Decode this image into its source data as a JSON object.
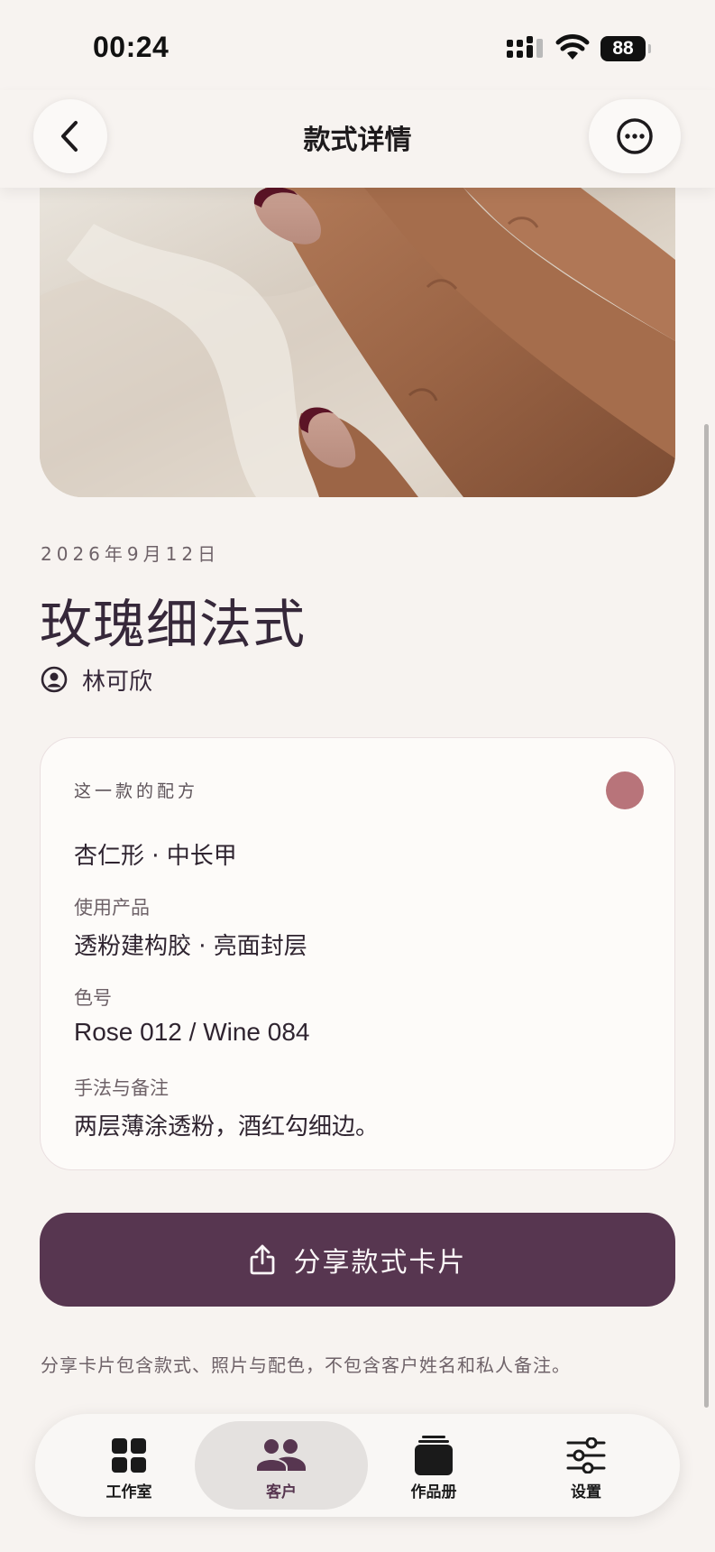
{
  "status_bar": {
    "time": "00:24",
    "battery": "88",
    "icons": [
      "cellular-signal-icon",
      "wifi-icon",
      "battery-icon"
    ]
  },
  "header": {
    "title": "款式详情",
    "back_icon": "chevron-left-icon",
    "more_icon": "ellipsis-circle-icon"
  },
  "style": {
    "date": "2026年9月12日",
    "title": "玫瑰细法式",
    "client_icon": "person-circle-icon",
    "client_name": "林可欣"
  },
  "recipe": {
    "heading": "这一款的配方",
    "swatch_color": "#b8747a",
    "shape": "杏仁形 · 中长甲",
    "fields": [
      {
        "label": "使用产品",
        "value": "透粉建构胶 · 亮面封层"
      },
      {
        "label": "色号",
        "value": "Rose 012 / Wine 084"
      },
      {
        "label": "手法与备注",
        "value": "两层薄涂透粉，酒红勾细边。"
      }
    ]
  },
  "share": {
    "icon": "share-icon",
    "label": "分享款式卡片",
    "note": "分享卡片包含款式、照片与配色，不包含客户姓名和私人备注。"
  },
  "tab_bar": {
    "active": "客户",
    "tabs": [
      {
        "label": "工作室",
        "icon": "grid-icon"
      },
      {
        "label": "客户",
        "icon": "people-icon"
      },
      {
        "label": "作品册",
        "icon": "album-stack-icon"
      },
      {
        "label": "设置",
        "icon": "sliders-icon"
      }
    ]
  },
  "colors": {
    "background": "#f7f3f0",
    "accent": "#573650",
    "text": "#36283a",
    "swatch": "#b8747a"
  }
}
